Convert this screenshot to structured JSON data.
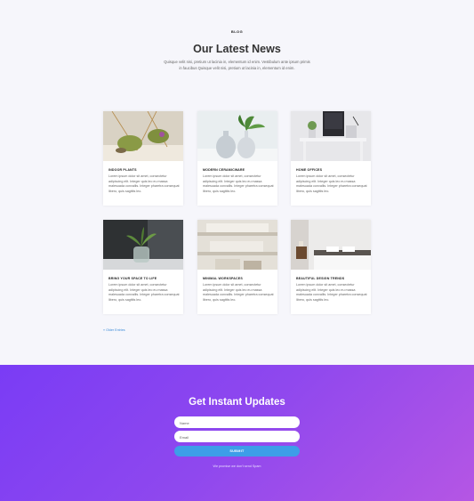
{
  "blog": {
    "eyebrow": "BLOG",
    "title": "Our Latest News",
    "intro_line1": "Quisque velit nisi, pretium ut lacinia in, elementum id enim. Vestibulum ante ipsum primis",
    "intro_line2": "in faucibus Quisque velit nisi, pretium ut lacinia in, elementum id enim.",
    "posts": [
      {
        "title": "INDOOR PLANTS",
        "excerpt": "Lorem ipsum dolor sit amet, consectetur adipiscing elit. Integer quis leo eu massa malesuada convallis. Integer pharetra consequat libero, quis sagittis leo."
      },
      {
        "title": "MODERN CERAMICWARE",
        "excerpt": "Lorem ipsum dolor sit amet, consectetur adipiscing elit. Integer quis leo eu massa malesuada convallis. Integer pharetra consequat libero, quis sagittis leo."
      },
      {
        "title": "HOME OFFICES",
        "excerpt": "Lorem ipsum dolor sit amet, consectetur adipiscing elit. Integer quis leo eu massa malesuada convallis. Integer pharetra consequat libero, quis sagittis leo."
      },
      {
        "title": "BRING YOUR SPACE TO LIFE",
        "excerpt": "Lorem ipsum dolor sit amet, consectetur adipiscing elit. Integer quis leo eu massa malesuada convallis. Integer pharetra consequat libero, quis sagittis leo."
      },
      {
        "title": "MINIMAL WORKSPACES",
        "excerpt": "Lorem ipsum dolor sit amet, consectetur adipiscing elit. Integer quis leo eu massa malesuada convallis. Integer pharetra consequat libero, quis sagittis leo."
      },
      {
        "title": "BEAUTIFUL DESIGN TRENDS",
        "excerpt": "Lorem ipsum dolor sit amet, consectetur adipiscing elit. Integer quis leo eu massa malesuada convallis. Integer pharetra consequat libero, quis sagittis leo."
      }
    ],
    "older_entries": "« Older Entries"
  },
  "subscribe": {
    "title": "Get Instant Updates",
    "name_placeholder": "Name",
    "email_placeholder": "Email",
    "submit_label": "SUBMIT",
    "promise": "We promise we don't send Spam"
  },
  "colors": {
    "gradient_start": "#7a3cf5",
    "gradient_end": "#b556e4",
    "submit": "#3d9ee8",
    "link": "#3b8bd8"
  }
}
